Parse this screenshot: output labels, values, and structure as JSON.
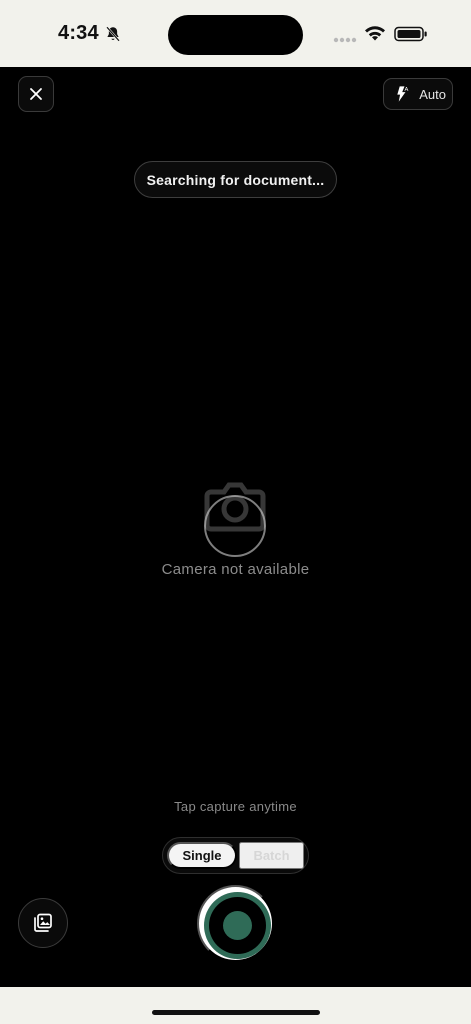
{
  "status_bar": {
    "time": "4:34",
    "icons": [
      "bell-slash-icon",
      "signal-dots-icon",
      "wifi-icon",
      "battery-icon"
    ]
  },
  "top_controls": {
    "close_icon": "close-icon",
    "flash_icon": "flash-auto-icon",
    "flash_label": "Auto"
  },
  "scanner": {
    "status_pill": "Searching for document...",
    "camera_icon": "camera-icon",
    "camera_status": "Camera not available"
  },
  "bottom_controls": {
    "hint": "Tap capture anytime",
    "modes": [
      {
        "label": "Single",
        "selected": true
      },
      {
        "label": "Batch",
        "selected": false
      }
    ],
    "gallery_icon": "gallery-icon",
    "capture_icon": "capture-button-icon"
  },
  "colors": {
    "background": "#000000",
    "system_bar": "#f2f2ec",
    "accent": "#2f6b57"
  }
}
